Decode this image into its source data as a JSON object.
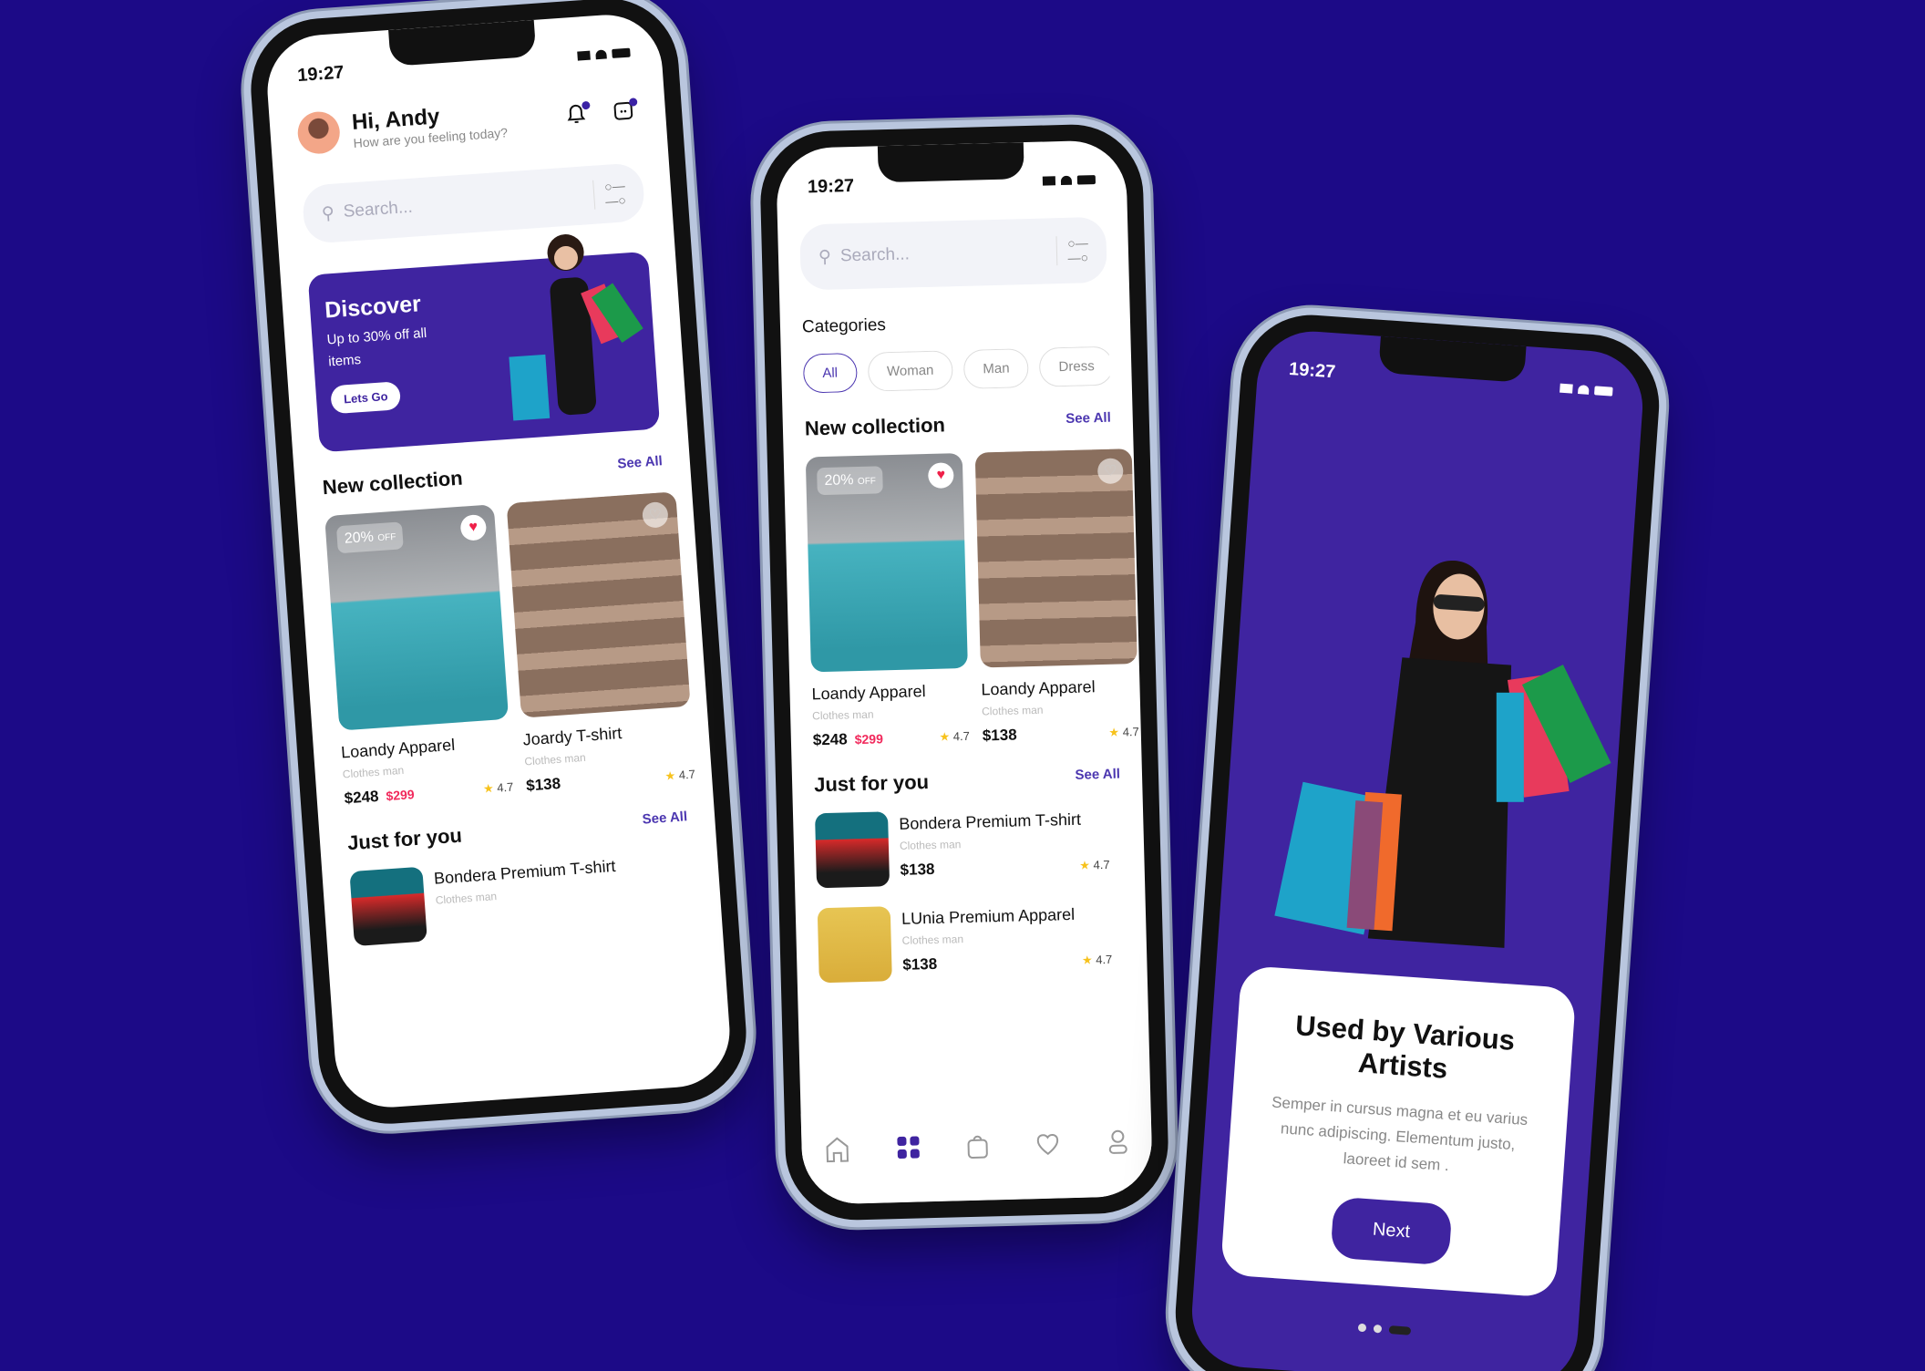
{
  "colors": {
    "background": "#1c0a87",
    "accent": "#3f24a0",
    "sale": "#f1285b",
    "star": "#f7c21c"
  },
  "status": {
    "time": "19:27"
  },
  "home": {
    "greeting": "Hi, Andy",
    "subtitle": "How are you feeling today?",
    "search_placeholder": "Search...",
    "banner": {
      "title": "Discover",
      "text": "Up to 30% off all items",
      "button": "Lets Go"
    },
    "new_collection": {
      "title": "New collection",
      "see_all": "See All",
      "items": [
        {
          "name": "Loandy Apparel",
          "category": "Clothes man",
          "price": "$248",
          "old_price": "$299",
          "rating": "4.7",
          "badge": "20%",
          "badge_suffix": "OFF",
          "favorite": true
        },
        {
          "name": "Joardy T-shirt",
          "category": "Clothes man",
          "price": "$138",
          "rating": "4.7",
          "favorite": false
        }
      ]
    },
    "just_for_you": {
      "title": "Just for you",
      "see_all": "See All",
      "items": [
        {
          "name": "Bondera Premium T-shirt",
          "category": "Clothes man"
        }
      ]
    }
  },
  "catalog": {
    "search_placeholder": "Search...",
    "categories_title": "Categories",
    "categories": [
      "All",
      "Woman",
      "Man",
      "Dress"
    ],
    "new_collection": {
      "title": "New collection",
      "see_all": "See All",
      "items": [
        {
          "name": "Loandy Apparel",
          "category": "Clothes man",
          "price": "$248",
          "old_price": "$299",
          "rating": "4.7",
          "badge": "20%",
          "badge_suffix": "OFF",
          "favorite": true
        },
        {
          "name": "Loandy Apparel",
          "category": "Clothes man",
          "price": "$138",
          "rating": "4.7",
          "favorite": false
        }
      ]
    },
    "just_for_you": {
      "title": "Just for you",
      "see_all": "See All",
      "items": [
        {
          "name": "Bondera Premium T-shirt",
          "category": "Clothes man",
          "price": "$138",
          "rating": "4.7"
        },
        {
          "name": "LUnia Premium Apparel",
          "category": "Clothes man",
          "price": "$138",
          "rating": "4.7"
        }
      ]
    },
    "tabs": [
      {
        "icon": "home-icon"
      },
      {
        "icon": "grid-icon",
        "active": true
      },
      {
        "icon": "bag-icon"
      },
      {
        "icon": "heart-icon"
      },
      {
        "icon": "profile-icon"
      }
    ]
  },
  "onboarding": {
    "title": "Used by Various Artists",
    "text": "Semper in cursus magna et eu varius nunc adipiscing. Elementum justo, laoreet id sem .",
    "button": "Next",
    "page_index": 3,
    "page_count": 3
  }
}
